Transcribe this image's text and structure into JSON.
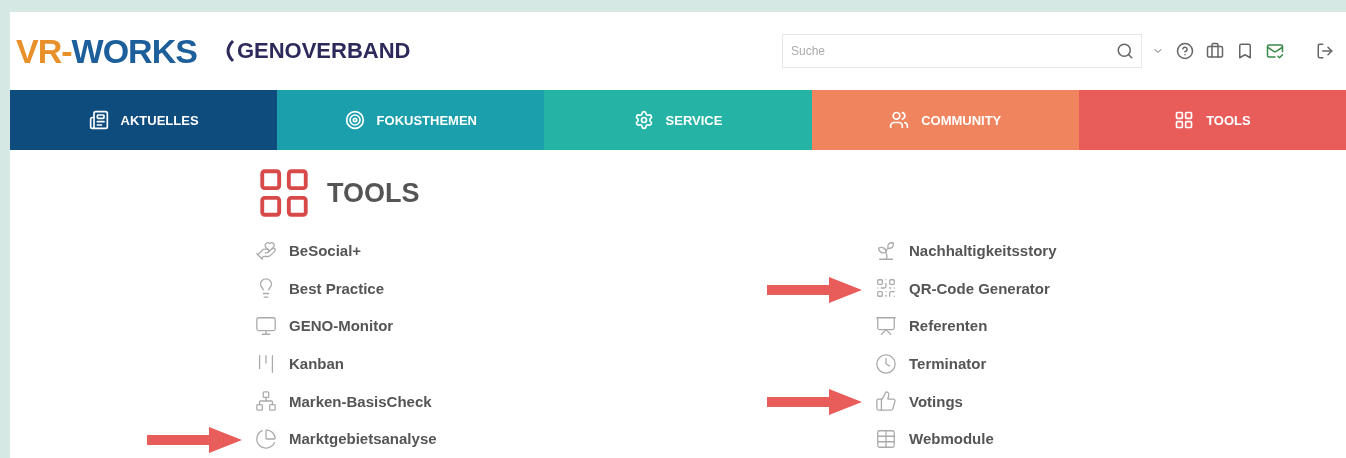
{
  "header": {
    "logo": {
      "part_1": "VR-",
      "part_2": "WORKS"
    },
    "partner_logo": "GENOVERBAND",
    "search": {
      "placeholder": "Suche"
    }
  },
  "nav": [
    {
      "label": "AKTUELLES",
      "color": "#0f4c7e"
    },
    {
      "label": "FOKUSTHEMEN",
      "color": "#1c9fad"
    },
    {
      "label": "SERVICE",
      "color": "#25b3a6"
    },
    {
      "label": "COMMUNITY",
      "color": "#f0845e"
    },
    {
      "label": "TOOLS",
      "color": "#e85c5a"
    }
  ],
  "section": {
    "title": "TOOLS"
  },
  "columns": [
    [
      {
        "label": "BeSocial+",
        "marked": false
      },
      {
        "label": "Best Practice",
        "marked": false
      },
      {
        "label": "GENO-Monitor",
        "marked": false
      },
      {
        "label": "Kanban",
        "marked": false
      },
      {
        "label": "Marken-BasisCheck",
        "marked": false
      },
      {
        "label": "Marktgebietsanalyse",
        "marked": true
      }
    ],
    [
      {
        "label": "Nachhaltigkeitsstory",
        "marked": false
      },
      {
        "label": "QR-Code Generator",
        "marked": true
      },
      {
        "label": "Referenten",
        "marked": false
      },
      {
        "label": "Terminator",
        "marked": false
      },
      {
        "label": "Votings",
        "marked": true
      },
      {
        "label": "Webmodule",
        "marked": false
      }
    ]
  ]
}
